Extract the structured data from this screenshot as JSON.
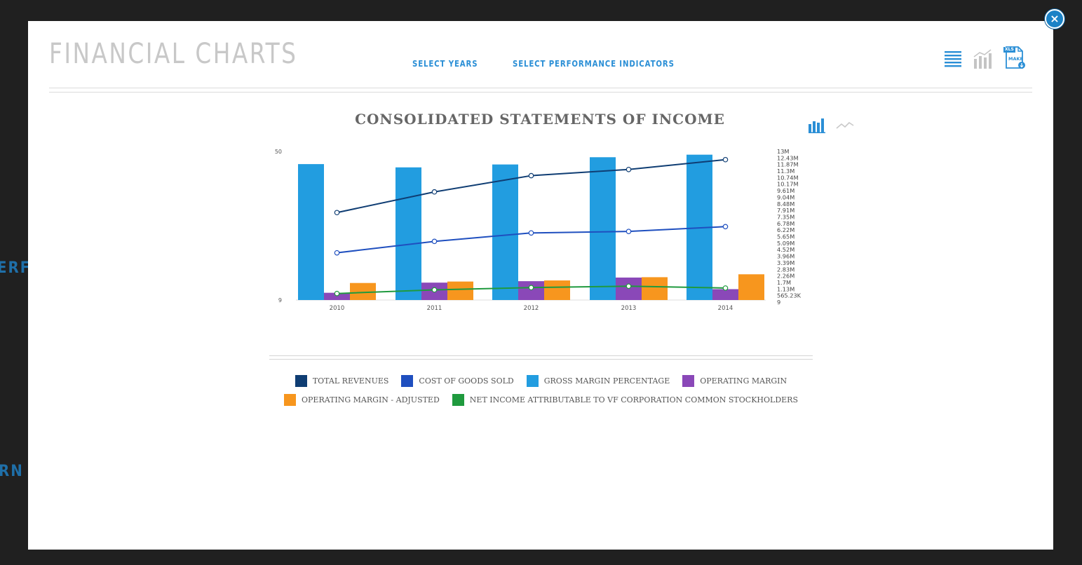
{
  "modal": {
    "title": "FINANCIAL CHARTS",
    "nav": [
      {
        "label": "SELECT YEARS"
      },
      {
        "label": "SELECT PERFORMANCE INDICATORS"
      }
    ],
    "close_glyph": "×",
    "toolbar": {
      "table_icon": "list-view-icon",
      "chart_icon": "chart-view-icon",
      "xls_badge": "XLS",
      "xls_label": "MAKE"
    }
  },
  "background": {
    "peek_text_1": "ERF",
    "peek_text_2": "RN"
  },
  "chart_data": {
    "type": "bar",
    "title": "CONSOLIDATED STATEMENTS OF INCOME",
    "chart_type_icons": [
      "bar-chart-icon",
      "line-chart-icon"
    ],
    "categories": [
      "2010",
      "2011",
      "2012",
      "2013",
      "2014"
    ],
    "left_axis": {
      "ticks": [
        "50",
        "9"
      ],
      "ylim": [
        9,
        50
      ]
    },
    "right_axis": {
      "ticks": [
        "13M",
        "12.43M",
        "11.87M",
        "11.3M",
        "10.74M",
        "10.17M",
        "9.61M",
        "9.04M",
        "8.48M",
        "7.91M",
        "7.35M",
        "6.78M",
        "6.22M",
        "5.65M",
        "5.09M",
        "4.52M",
        "3.96M",
        "3.39M",
        "2.83M",
        "2.26M",
        "1.7M",
        "1.13M",
        "565.23K",
        "9"
      ],
      "ylim": [
        9,
        13000000
      ]
    },
    "series": [
      {
        "name": "TOTAL REVENUES",
        "type": "line",
        "axis": "right",
        "color": "#0f3d73",
        "values": [
          7650000,
          9460000,
          10880000,
          11420000,
          12280000
        ]
      },
      {
        "name": "COST OF GOODS SOLD",
        "type": "line",
        "axis": "right",
        "color": "#1f4fbf",
        "values": [
          4130000,
          5130000,
          5870000,
          6000000,
          6420000
        ]
      },
      {
        "name": "GROSS MARGIN PERCENTAGE",
        "type": "bar",
        "axis": "left",
        "color": "#229de0",
        "values": [
          46.5,
          45.6,
          46.4,
          48.4,
          49.1
        ]
      },
      {
        "name": "OPERATING MARGIN",
        "type": "bar",
        "axis": "left",
        "color": "#8a48b8",
        "values": [
          11.0,
          13.8,
          14.2,
          15.2,
          12.0
        ]
      },
      {
        "name": "OPERATING MARGIN - ADJUSTED",
        "type": "bar",
        "axis": "left",
        "color": "#f7961e",
        "values": [
          13.7,
          14.1,
          14.4,
          15.3,
          16.1
        ]
      },
      {
        "name": "NET INCOME ATTRIBUTABLE TO VF CORPORATION COMMON STOCKHOLDERS",
        "type": "line",
        "axis": "right",
        "color": "#1f9a3e",
        "values": [
          570000,
          890000,
          1090000,
          1210000,
          1050000
        ]
      }
    ],
    "legend_position": "bottom",
    "grid": false
  }
}
